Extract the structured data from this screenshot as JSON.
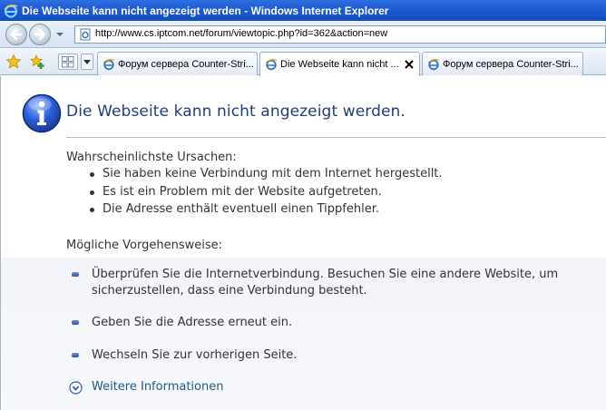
{
  "window": {
    "title": "Die Webseite kann nicht angezeigt werden - Windows Internet Explorer"
  },
  "address_bar": {
    "url": "http://www.cs.iptcom.net/forum/viewtopic.php?id=362&action=new"
  },
  "tabs": [
    {
      "label": "Форум сервера Counter-Stri...",
      "active": false
    },
    {
      "label": "Die Webseite kann nicht ...",
      "active": true
    },
    {
      "label": "Форум сервера Counter-Stri...",
      "active": false
    }
  ],
  "page": {
    "title": "Die Webseite kann nicht angezeigt werden.",
    "causes_label": "Wahrscheinlichste Ursachen:",
    "causes": [
      "Sie haben keine Verbindung mit dem Internet hergestellt.",
      "Es ist ein Problem mit der Website aufgetreten.",
      "Die Adresse enthält eventuell einen Tippfehler."
    ],
    "actions_label": "Mögliche Vorgehensweise:",
    "actions": [
      "Überprüfen Sie die Internetverbindung. Besuchen Sie eine andere Website, um sicherzustellen, dass eine Verbindung besteht.",
      "Geben Sie die Adresse erneut ein.",
      "Wechseln Sie zur vorherigen Seite."
    ],
    "more_info": "Weitere Informationen"
  },
  "colors": {
    "titlebar": "#1e5bd2",
    "page_title": "#1f3f7a",
    "link": "#1b5b8a"
  }
}
